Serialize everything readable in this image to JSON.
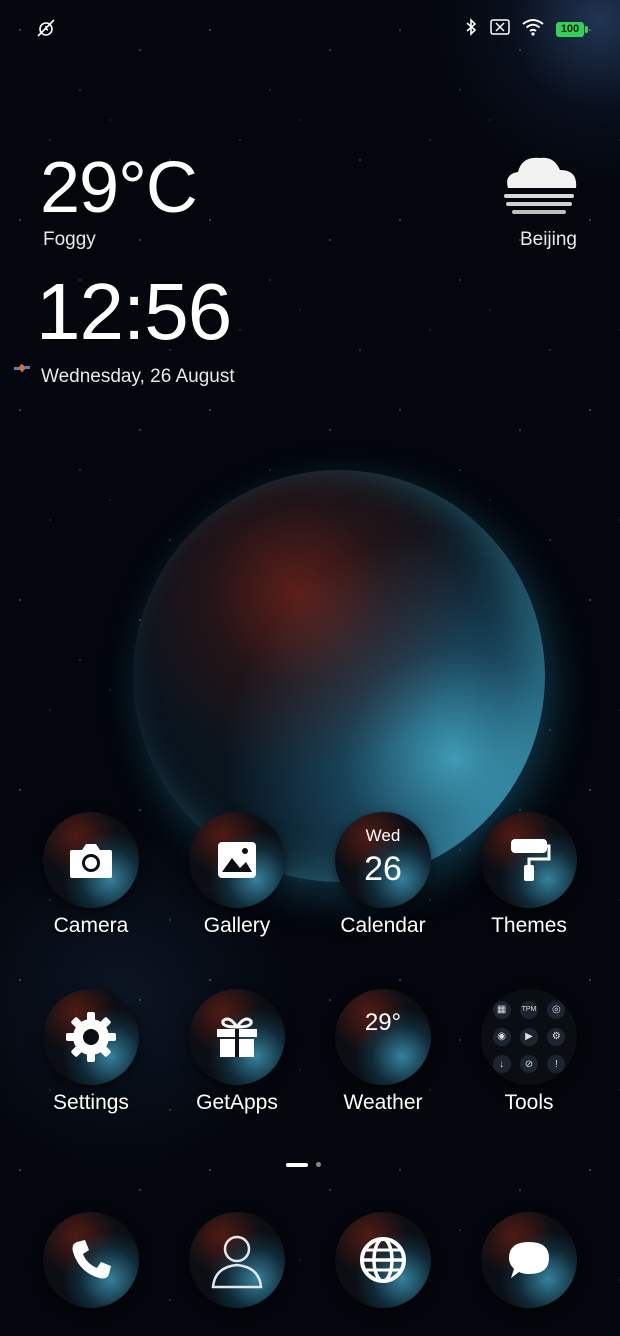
{
  "status_bar": {
    "battery": "100",
    "icons": [
      "alarm-off-icon",
      "bluetooth-icon",
      "no-sim-icon",
      "wifi-icon",
      "battery-icon"
    ]
  },
  "weather_widget": {
    "temperature": "29°C",
    "condition": "Foggy",
    "city": "Beijing",
    "icon": "fog-cloud-icon"
  },
  "clock": {
    "time": "12:56",
    "date": "Wednesday, 26 August"
  },
  "apps": [
    {
      "label": "Camera",
      "icon": "camera-icon"
    },
    {
      "label": "Gallery",
      "icon": "image-icon"
    },
    {
      "label": "Calendar",
      "icon": "calendar-icon",
      "day": "Wed",
      "date": "26"
    },
    {
      "label": "Themes",
      "icon": "paint-roller-icon"
    },
    {
      "label": "Settings",
      "icon": "gear-icon"
    },
    {
      "label": "GetApps",
      "icon": "gift-icon"
    },
    {
      "label": "Weather",
      "icon": "weather-icon",
      "temp": "29°"
    },
    {
      "label": "Tools",
      "icon": "tools-folder-icon"
    }
  ],
  "tools_folder": {
    "mini": [
      "▦",
      "TPM",
      "◎",
      "◉",
      "▶",
      "⚙",
      "↓",
      "⊘",
      "!"
    ]
  },
  "pager": {
    "pages": 2,
    "current": 1
  },
  "dock": [
    {
      "icon": "phone-icon"
    },
    {
      "icon": "contacts-icon"
    },
    {
      "icon": "browser-globe-icon"
    },
    {
      "icon": "messages-icon"
    }
  ]
}
